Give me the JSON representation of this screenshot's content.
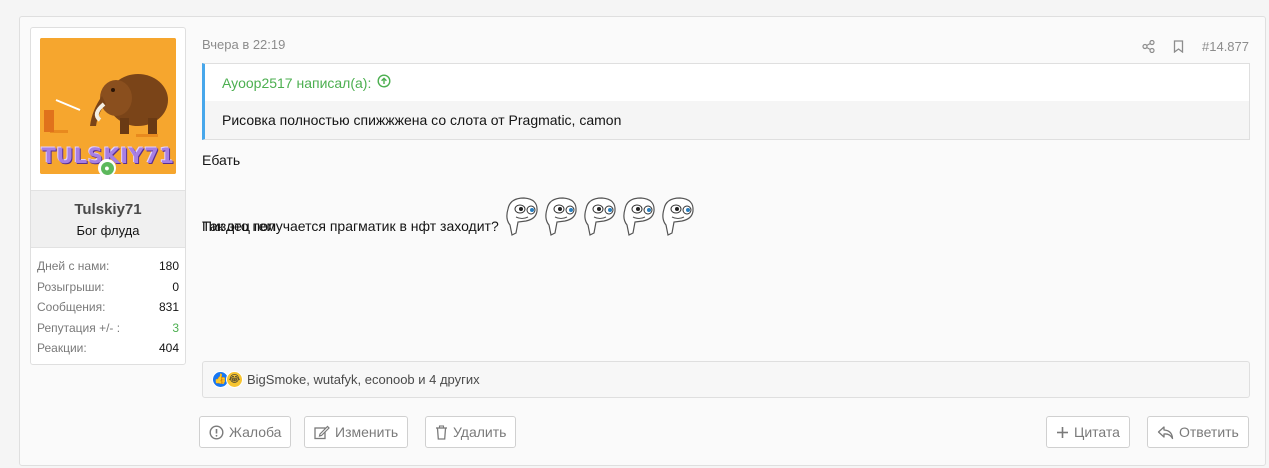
{
  "user": {
    "avatar_text": "TULSKIY71",
    "name": "Tulskiy71",
    "title": "Бог флуда",
    "stats": [
      {
        "label": "Дней с нами:",
        "value": "180"
      },
      {
        "label": "Розыгрыши:",
        "value": "0"
      },
      {
        "label": "Сообщения:",
        "value": "831"
      },
      {
        "label": "Репутация +/- :",
        "value": "3"
      },
      {
        "label": "Реакции:",
        "value": "404"
      }
    ]
  },
  "post": {
    "date": "Вчера в 22:19",
    "number": "#14.877"
  },
  "quote": {
    "author": "Ayoop2517 написал(а):",
    "text": "Рисовка полностью спижжжена со слота от Pragmatic, camon"
  },
  "message": {
    "line1": "Ебать",
    "line2": "Так это получается прагматик в нфт заходит?",
    "line3": "Пиздец гем"
  },
  "reactions": {
    "text": "BigSmoke, wutafyk, econoob и 4 других"
  },
  "actions": {
    "report": "Жалоба",
    "edit": "Изменить",
    "delete": "Удалить",
    "quote": "Цитата",
    "reply": "Ответить"
  },
  "colors": {
    "accent_green": "#4caf50",
    "quote_border": "#47a7eb",
    "avatar_bg": "#f6a62e"
  }
}
